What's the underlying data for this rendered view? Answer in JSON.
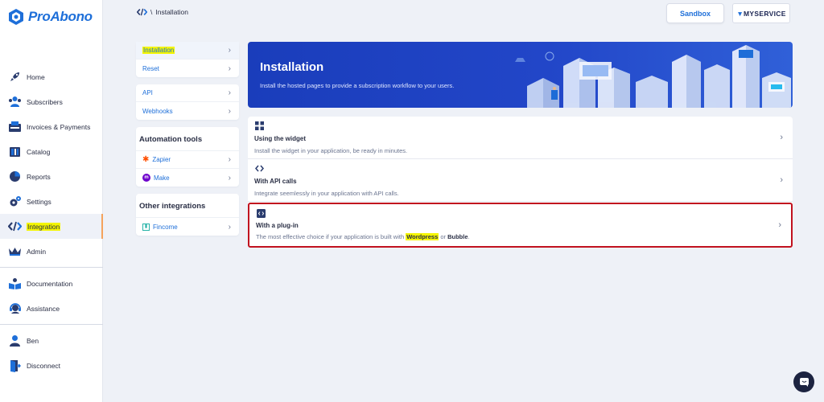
{
  "app": {
    "name": "ProAbono"
  },
  "nav": {
    "items": [
      {
        "label": "Home",
        "icon": "rocket-icon"
      },
      {
        "label": "Subscribers",
        "icon": "subscribers-icon"
      },
      {
        "label": "Invoices & Payments",
        "icon": "invoice-icon"
      },
      {
        "label": "Catalog",
        "icon": "catalog-icon"
      },
      {
        "label": "Reports",
        "icon": "pie-chart-icon"
      },
      {
        "label": "Settings",
        "icon": "gears-icon"
      },
      {
        "label": "Integration",
        "icon": "code-icon",
        "active": true
      },
      {
        "label": "Admin",
        "icon": "crown-icon"
      }
    ],
    "secondary": [
      {
        "label": "Documentation",
        "icon": "book-icon"
      },
      {
        "label": "Assistance",
        "icon": "headset-icon"
      }
    ],
    "account": [
      {
        "label": "Ben",
        "icon": "user-icon"
      },
      {
        "label": "Disconnect",
        "icon": "door-icon"
      }
    ]
  },
  "breadcrumb": {
    "separator": "\\",
    "current": "Installation"
  },
  "topbar": {
    "sandbox_label": "Sandbox",
    "service_brand": "MYSERVICE"
  },
  "menu": {
    "group1": [
      {
        "label": "Installation"
      },
      {
        "label": "Reset"
      }
    ],
    "group2": [
      {
        "label": "API"
      },
      {
        "label": "Webhooks"
      }
    ],
    "automation": {
      "title": "Automation tools",
      "items": [
        {
          "label": "Zapier"
        },
        {
          "label": "Make"
        }
      ]
    },
    "other": {
      "title": "Other integrations",
      "items": [
        {
          "label": "Fincome"
        }
      ]
    }
  },
  "banner": {
    "title": "Installation",
    "subtitle": "Install the hosted pages to provide a subscription workflow to your users."
  },
  "options": [
    {
      "title": "Using the widget",
      "description": "Install the widget in your application, be ready in minutes.",
      "icon": "widget-icon"
    },
    {
      "title": "With API calls",
      "description": "Integrate seemlessly in your application with API calls.",
      "icon": "code-brackets-icon"
    },
    {
      "title": "With a plug-in",
      "description_prefix": "The most effective choice if your application is built with ",
      "wordpress": "Wordpress",
      "or": " or ",
      "bubble": "Bubble",
      "period": ".",
      "icon": "plugin-icon"
    }
  ],
  "colors": {
    "accent": "#1e6fd9",
    "banner": "#2246c8",
    "highlight_border": "#c1121f",
    "highlight_marker": "#f4f500"
  }
}
